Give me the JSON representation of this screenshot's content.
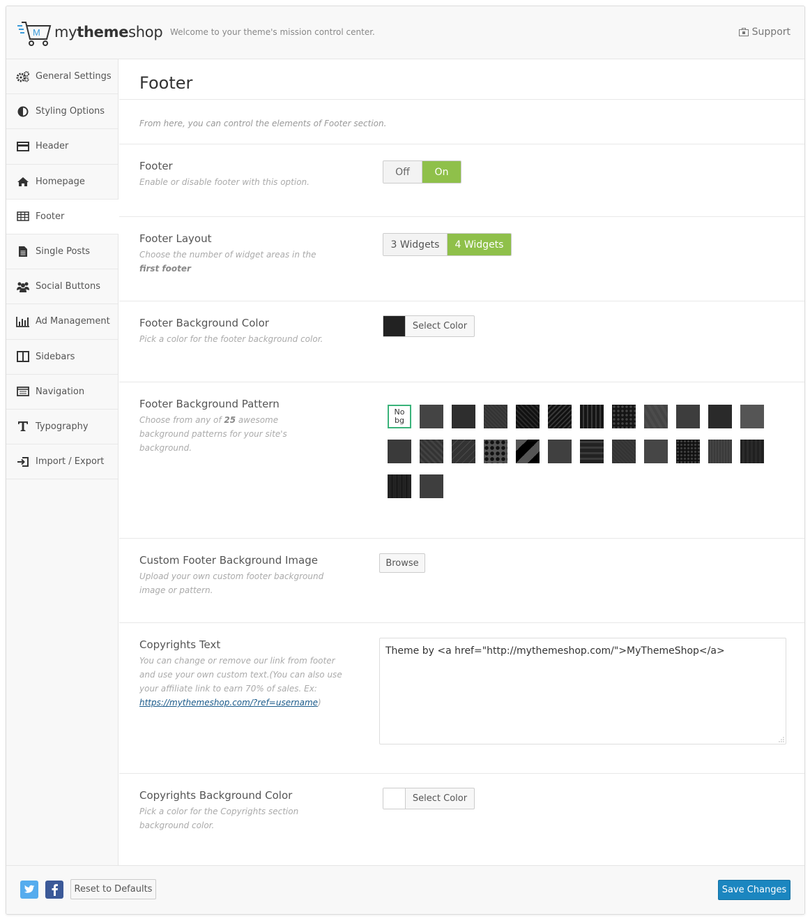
{
  "header": {
    "logo_regular": "my",
    "logo_bold": "theme",
    "logo_end": "shop",
    "welcome": "Welcome to your theme's mission control center.",
    "support_label": "Support"
  },
  "sidebar": {
    "items": [
      {
        "label": "General Settings",
        "icon": "gears-icon"
      },
      {
        "label": "Styling Options",
        "icon": "contrast-icon"
      },
      {
        "label": "Header",
        "icon": "header-icon"
      },
      {
        "label": "Homepage",
        "icon": "home-icon"
      },
      {
        "label": "Footer",
        "icon": "table-icon"
      },
      {
        "label": "Single Posts",
        "icon": "document-icon"
      },
      {
        "label": "Social Buttons",
        "icon": "users-icon"
      },
      {
        "label": "Ad Management",
        "icon": "bar-chart-icon"
      },
      {
        "label": "Sidebars",
        "icon": "columns-icon"
      },
      {
        "label": "Navigation",
        "icon": "list-icon"
      },
      {
        "label": "Typography",
        "icon": "typography-icon"
      },
      {
        "label": "Import / Export",
        "icon": "import-icon"
      }
    ]
  },
  "page": {
    "title": "Footer",
    "description": "From here, you can control the elements of Footer section."
  },
  "options": {
    "footer": {
      "title": "Footer",
      "desc": "Enable or disable footer with this option.",
      "off": "Off",
      "on": "On"
    },
    "layout": {
      "title": "Footer Layout",
      "desc_a": "Choose the number of widget areas in the ",
      "desc_b": "first footer",
      "opt3": "3 Widgets",
      "opt4": "4 Widgets"
    },
    "bg_color": {
      "title": "Footer Background Color",
      "desc": "Pick a color for the footer background color.",
      "button": "Select Color",
      "swatch": "#222222"
    },
    "bg_pattern": {
      "title": "Footer Background Pattern",
      "desc_a": "Choose from any of ",
      "desc_count": "25",
      "desc_b": " awesome background patterns for your site's background.",
      "nobg_label": "No bg"
    },
    "custom_bg": {
      "title": "Custom Footer Background Image",
      "desc": "Upload your own custom footer background image or pattern.",
      "button": "Browse"
    },
    "copyrights": {
      "title": "Copyrights Text",
      "desc": "You can change or remove our link from footer and use your own custom text.(You can also use your affiliate link to earn 70% of sales. Ex: ",
      "link": "https://mythemeshop.com/?ref=username",
      "desc_end": ")",
      "value": "Theme by <a href=\"http://mythemeshop.com/\">MyThemeShop</a>"
    },
    "copyrights_color": {
      "title": "Copyrights Background Color",
      "desc": "Pick a color for the Copyrights section background color.",
      "button": "Select Color",
      "swatch": "#ffffff"
    }
  },
  "footer": {
    "reset_label": "Reset to Defaults",
    "save_label": "Save Changes"
  },
  "colors": {
    "accent_green": "#8fc04a",
    "primary_blue": "#1b86c0",
    "twitter": "#55acee",
    "facebook": "#3b5998"
  }
}
